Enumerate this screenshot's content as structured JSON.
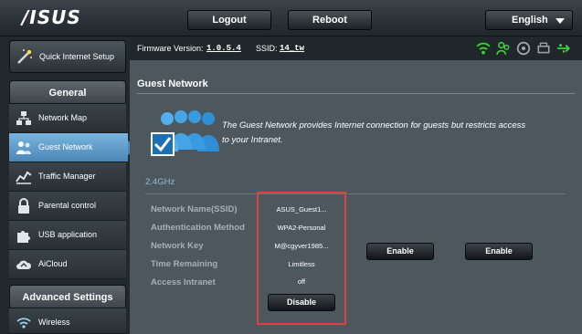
{
  "brand": {
    "logo_text": "/ISUS"
  },
  "header": {
    "logout_label": "Logout",
    "reboot_label": "Reboot",
    "language_label": "English"
  },
  "firmware_bar": {
    "firmware_label": "Firmware Version:",
    "firmware_value": "1.0.5.4",
    "ssid_label": "SSID:",
    "ssid_value": "14_tw"
  },
  "sidebar": {
    "quick_setup_label": "Quick Internet Setup",
    "general_header": "General",
    "items": [
      {
        "label": "Network Map",
        "icon": "network-map-icon"
      },
      {
        "label": "Guest Network",
        "icon": "guest-network-icon",
        "active": true
      },
      {
        "label": "Traffic Manager",
        "icon": "traffic-manager-icon"
      },
      {
        "label": "Parental control",
        "icon": "lock-icon"
      },
      {
        "label": "USB application",
        "icon": "puzzle-icon"
      },
      {
        "label": "AiCloud",
        "icon": "cloud-icon"
      }
    ],
    "advanced_header": "Advanced Settings",
    "advanced_items": [
      {
        "label": "Wireless",
        "icon": "wifi-icon"
      }
    ]
  },
  "main": {
    "title": "Guest Network",
    "description": "The Guest Network provides Internet connection for guests but restricts access to your Intranet.",
    "band": "2.4GHz",
    "fields": [
      {
        "label": "Network Name(SSID)",
        "value": "ASUS_Guest1..."
      },
      {
        "label": "Authentication Method",
        "value": "WPA2-Personal"
      },
      {
        "label": "Network Key",
        "value": "M@cgyver1985..."
      },
      {
        "label": "Time Remaining",
        "value": "Limitless"
      },
      {
        "label": "Access Intranet",
        "value": "off"
      }
    ],
    "disable_label": "Disable",
    "enable_label_1": "Enable",
    "enable_label_2": "Enable"
  },
  "colors": {
    "accent": "#4b86b6",
    "highlight": "#e0413d",
    "band_text": "#8fbbd9",
    "status_green": "#3fd43a"
  }
}
